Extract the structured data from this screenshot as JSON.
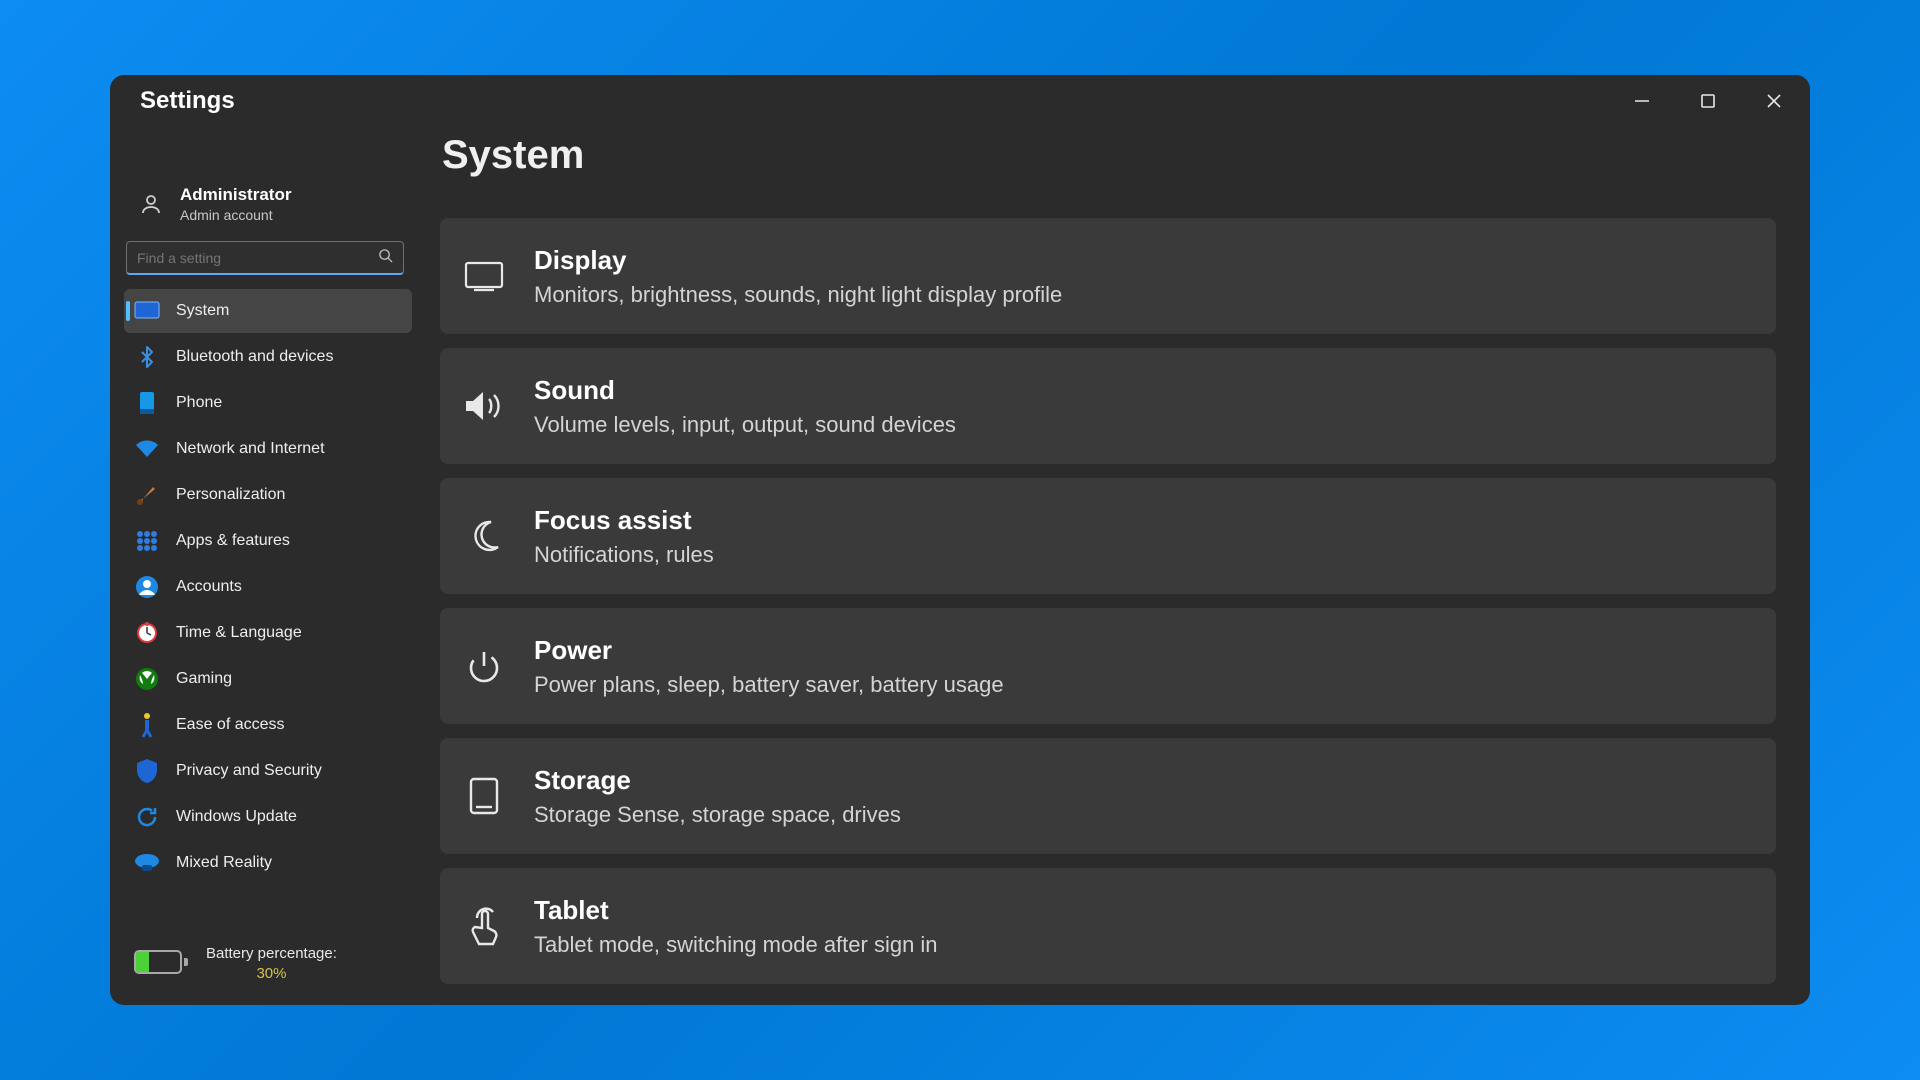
{
  "window": {
    "title": "Settings"
  },
  "account": {
    "name": "Administrator",
    "sub": "Admin account"
  },
  "search": {
    "placeholder": "Find a setting"
  },
  "sidebar": {
    "items": [
      {
        "label": "System"
      },
      {
        "label": "Bluetooth and devices"
      },
      {
        "label": "Phone"
      },
      {
        "label": "Network and Internet"
      },
      {
        "label": "Personalization"
      },
      {
        "label": "Apps & features"
      },
      {
        "label": "Accounts"
      },
      {
        "label": "Time & Language"
      },
      {
        "label": "Gaming"
      },
      {
        "label": "Ease of access"
      },
      {
        "label": "Privacy and Security"
      },
      {
        "label": "Windows Update"
      },
      {
        "label": "Mixed Reality"
      }
    ]
  },
  "battery": {
    "label": "Battery percentage:",
    "value": "30%",
    "fill_pct": 30
  },
  "page": {
    "title": "System"
  },
  "cards": [
    {
      "title": "Display",
      "sub": "Monitors, brightness, sounds, night light display profile"
    },
    {
      "title": "Sound",
      "sub": "Volume levels, input, output, sound devices"
    },
    {
      "title": "Focus assist",
      "sub": "Notifications, rules"
    },
    {
      "title": "Power",
      "sub": "Power plans, sleep, battery saver, battery usage"
    },
    {
      "title": "Storage",
      "sub": "Storage Sense, storage space, drives"
    },
    {
      "title": "Tablet",
      "sub": "Tablet mode, switching mode after sign in"
    }
  ]
}
